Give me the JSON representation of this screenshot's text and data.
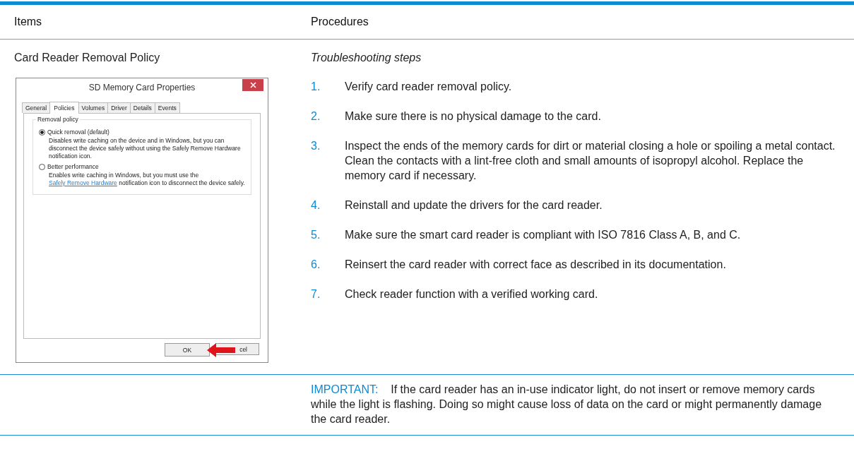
{
  "table": {
    "columns": [
      "Items",
      "Procedures"
    ],
    "row": {
      "item": "Card Reader Removal Policy",
      "dialog": {
        "title": "SD Memory Card Properties",
        "tabs": [
          {
            "label": "General",
            "selected": false
          },
          {
            "label": "Policies",
            "selected": true
          },
          {
            "label": "Volumes",
            "selected": false
          },
          {
            "label": "Driver",
            "selected": false
          },
          {
            "label": "Details",
            "selected": false
          },
          {
            "label": "Events",
            "selected": false
          }
        ],
        "group_label": "Removal policy",
        "options": [
          {
            "label": "Quick removal (default)",
            "selected": true,
            "description": [
              {
                "text": "Disables write caching on the device and in Windows, but you can disconnect the device safely without using the Safely Remove Hardware notification icon."
              }
            ]
          },
          {
            "label": "Better performance",
            "selected": false,
            "description": [
              {
                "text": "Enables write caching in Windows, but you must use the "
              },
              {
                "text": "Safely Remove Hardware",
                "link": true
              },
              {
                "text": " notification icon to disconnect the device safely."
              }
            ]
          }
        ],
        "buttons": [
          "OK",
          "cel"
        ]
      },
      "procedure_title": "Troubleshooting steps",
      "steps": [
        {
          "number": "1.",
          "text": "Verify card reader removal policy."
        },
        {
          "number": "2.",
          "text": "Make sure there is no physical damage to the card."
        },
        {
          "number": "3.",
          "text": "Inspect the ends of the memory cards for dirt or material closing a hole or spoiling a metal contact. Clean the contacts with a lint-free cloth and small amounts of isopropyl alcohol. Replace the memory card if necessary."
        },
        {
          "number": "4.",
          "text": "Reinstall and update the drivers for the card reader."
        },
        {
          "number": "5.",
          "text": "Make sure the smart card reader is compliant with ISO 7816 Class A, B, and C."
        },
        {
          "number": "6.",
          "text": "Reinsert the card reader with correct face as described in its documentation."
        },
        {
          "number": "7.",
          "text": "Check reader function with a verified working card."
        }
      ]
    },
    "note": {
      "label": "IMPORTANT:",
      "text": "If the card reader has an in-use indicator light, do not insert or remove memory cards while the light is flashing. Doing so might cause loss of data on the card or might permanently damage the card reader."
    }
  }
}
